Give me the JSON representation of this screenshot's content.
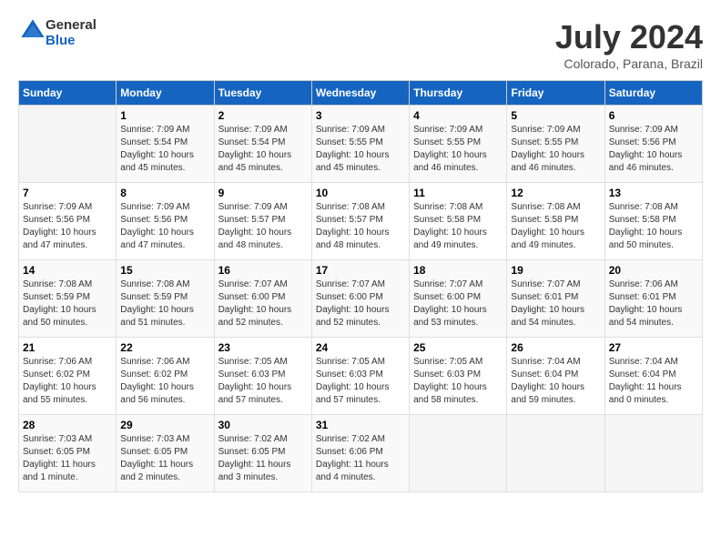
{
  "header": {
    "logo": {
      "text_general": "General",
      "text_blue": "Blue"
    },
    "title": "July 2024",
    "location": "Colorado, Parana, Brazil"
  },
  "days_of_week": [
    "Sunday",
    "Monday",
    "Tuesday",
    "Wednesday",
    "Thursday",
    "Friday",
    "Saturday"
  ],
  "weeks": [
    [
      {
        "day": "",
        "sunrise": "",
        "sunset": "",
        "daylight": ""
      },
      {
        "day": "1",
        "sunrise": "Sunrise: 7:09 AM",
        "sunset": "Sunset: 5:54 PM",
        "daylight": "Daylight: 10 hours and 45 minutes."
      },
      {
        "day": "2",
        "sunrise": "Sunrise: 7:09 AM",
        "sunset": "Sunset: 5:54 PM",
        "daylight": "Daylight: 10 hours and 45 minutes."
      },
      {
        "day": "3",
        "sunrise": "Sunrise: 7:09 AM",
        "sunset": "Sunset: 5:55 PM",
        "daylight": "Daylight: 10 hours and 45 minutes."
      },
      {
        "day": "4",
        "sunrise": "Sunrise: 7:09 AM",
        "sunset": "Sunset: 5:55 PM",
        "daylight": "Daylight: 10 hours and 46 minutes."
      },
      {
        "day": "5",
        "sunrise": "Sunrise: 7:09 AM",
        "sunset": "Sunset: 5:55 PM",
        "daylight": "Daylight: 10 hours and 46 minutes."
      },
      {
        "day": "6",
        "sunrise": "Sunrise: 7:09 AM",
        "sunset": "Sunset: 5:56 PM",
        "daylight": "Daylight: 10 hours and 46 minutes."
      }
    ],
    [
      {
        "day": "7",
        "sunrise": "Sunrise: 7:09 AM",
        "sunset": "Sunset: 5:56 PM",
        "daylight": "Daylight: 10 hours and 47 minutes."
      },
      {
        "day": "8",
        "sunrise": "Sunrise: 7:09 AM",
        "sunset": "Sunset: 5:56 PM",
        "daylight": "Daylight: 10 hours and 47 minutes."
      },
      {
        "day": "9",
        "sunrise": "Sunrise: 7:09 AM",
        "sunset": "Sunset: 5:57 PM",
        "daylight": "Daylight: 10 hours and 48 minutes."
      },
      {
        "day": "10",
        "sunrise": "Sunrise: 7:08 AM",
        "sunset": "Sunset: 5:57 PM",
        "daylight": "Daylight: 10 hours and 48 minutes."
      },
      {
        "day": "11",
        "sunrise": "Sunrise: 7:08 AM",
        "sunset": "Sunset: 5:58 PM",
        "daylight": "Daylight: 10 hours and 49 minutes."
      },
      {
        "day": "12",
        "sunrise": "Sunrise: 7:08 AM",
        "sunset": "Sunset: 5:58 PM",
        "daylight": "Daylight: 10 hours and 49 minutes."
      },
      {
        "day": "13",
        "sunrise": "Sunrise: 7:08 AM",
        "sunset": "Sunset: 5:58 PM",
        "daylight": "Daylight: 10 hours and 50 minutes."
      }
    ],
    [
      {
        "day": "14",
        "sunrise": "Sunrise: 7:08 AM",
        "sunset": "Sunset: 5:59 PM",
        "daylight": "Daylight: 10 hours and 50 minutes."
      },
      {
        "day": "15",
        "sunrise": "Sunrise: 7:08 AM",
        "sunset": "Sunset: 5:59 PM",
        "daylight": "Daylight: 10 hours and 51 minutes."
      },
      {
        "day": "16",
        "sunrise": "Sunrise: 7:07 AM",
        "sunset": "Sunset: 6:00 PM",
        "daylight": "Daylight: 10 hours and 52 minutes."
      },
      {
        "day": "17",
        "sunrise": "Sunrise: 7:07 AM",
        "sunset": "Sunset: 6:00 PM",
        "daylight": "Daylight: 10 hours and 52 minutes."
      },
      {
        "day": "18",
        "sunrise": "Sunrise: 7:07 AM",
        "sunset": "Sunset: 6:00 PM",
        "daylight": "Daylight: 10 hours and 53 minutes."
      },
      {
        "day": "19",
        "sunrise": "Sunrise: 7:07 AM",
        "sunset": "Sunset: 6:01 PM",
        "daylight": "Daylight: 10 hours and 54 minutes."
      },
      {
        "day": "20",
        "sunrise": "Sunrise: 7:06 AM",
        "sunset": "Sunset: 6:01 PM",
        "daylight": "Daylight: 10 hours and 54 minutes."
      }
    ],
    [
      {
        "day": "21",
        "sunrise": "Sunrise: 7:06 AM",
        "sunset": "Sunset: 6:02 PM",
        "daylight": "Daylight: 10 hours and 55 minutes."
      },
      {
        "day": "22",
        "sunrise": "Sunrise: 7:06 AM",
        "sunset": "Sunset: 6:02 PM",
        "daylight": "Daylight: 10 hours and 56 minutes."
      },
      {
        "day": "23",
        "sunrise": "Sunrise: 7:05 AM",
        "sunset": "Sunset: 6:03 PM",
        "daylight": "Daylight: 10 hours and 57 minutes."
      },
      {
        "day": "24",
        "sunrise": "Sunrise: 7:05 AM",
        "sunset": "Sunset: 6:03 PM",
        "daylight": "Daylight: 10 hours and 57 minutes."
      },
      {
        "day": "25",
        "sunrise": "Sunrise: 7:05 AM",
        "sunset": "Sunset: 6:03 PM",
        "daylight": "Daylight: 10 hours and 58 minutes."
      },
      {
        "day": "26",
        "sunrise": "Sunrise: 7:04 AM",
        "sunset": "Sunset: 6:04 PM",
        "daylight": "Daylight: 10 hours and 59 minutes."
      },
      {
        "day": "27",
        "sunrise": "Sunrise: 7:04 AM",
        "sunset": "Sunset: 6:04 PM",
        "daylight": "Daylight: 11 hours and 0 minutes."
      }
    ],
    [
      {
        "day": "28",
        "sunrise": "Sunrise: 7:03 AM",
        "sunset": "Sunset: 6:05 PM",
        "daylight": "Daylight: 11 hours and 1 minute."
      },
      {
        "day": "29",
        "sunrise": "Sunrise: 7:03 AM",
        "sunset": "Sunset: 6:05 PM",
        "daylight": "Daylight: 11 hours and 2 minutes."
      },
      {
        "day": "30",
        "sunrise": "Sunrise: 7:02 AM",
        "sunset": "Sunset: 6:05 PM",
        "daylight": "Daylight: 11 hours and 3 minutes."
      },
      {
        "day": "31",
        "sunrise": "Sunrise: 7:02 AM",
        "sunset": "Sunset: 6:06 PM",
        "daylight": "Daylight: 11 hours and 4 minutes."
      },
      {
        "day": "",
        "sunrise": "",
        "sunset": "",
        "daylight": ""
      },
      {
        "day": "",
        "sunrise": "",
        "sunset": "",
        "daylight": ""
      },
      {
        "day": "",
        "sunrise": "",
        "sunset": "",
        "daylight": ""
      }
    ]
  ]
}
